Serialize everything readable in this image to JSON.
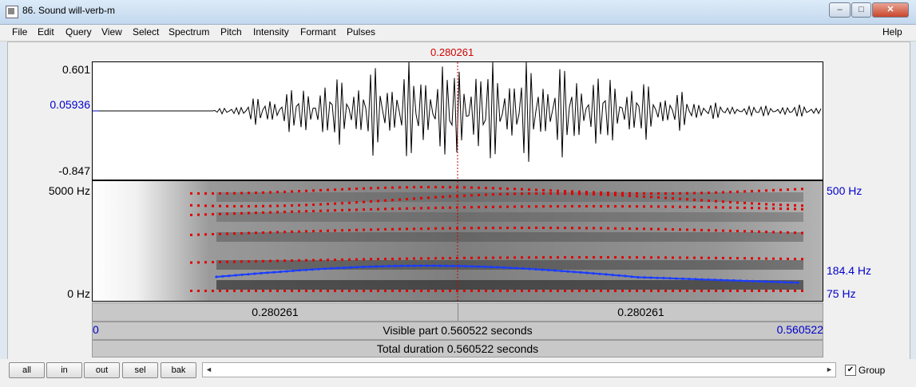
{
  "window": {
    "title": "86. Sound will-verb-m"
  },
  "menu": [
    "File",
    "Edit",
    "Query",
    "View",
    "Select",
    "Spectrum",
    "Pitch",
    "Intensity",
    "Formant",
    "Pulses",
    "Help"
  ],
  "cursor": {
    "time_label": "0.280261",
    "color": "#d00000"
  },
  "waveform": {
    "y_max": "0.601",
    "y_cursor": "0.05936",
    "y_min": "-0.847"
  },
  "spectrogram": {
    "freq_top": "5000 Hz",
    "freq_bottom": "0 Hz"
  },
  "pitch": {
    "top": "500 Hz",
    "value": "184.4 Hz",
    "bottom": "75 Hz",
    "color": "#1a3cff"
  },
  "formant_color": "#e00000",
  "time_bar": {
    "left": "0.280261",
    "right": "0.280261"
  },
  "visible": {
    "start": "0",
    "label": "Visible part 0.560522 seconds",
    "end": "0.560522"
  },
  "total": {
    "label": "Total duration 0.560522 seconds"
  },
  "buttons": [
    "all",
    "in",
    "out",
    "sel",
    "bak"
  ],
  "group": {
    "label": "Group",
    "checked": true,
    "check_glyph": "✔"
  },
  "scroll": {
    "left_glyph": "◄",
    "right_glyph": "►"
  },
  "window_buttons": {
    "minimize": "–",
    "maximize": "□",
    "close": "✕"
  }
}
